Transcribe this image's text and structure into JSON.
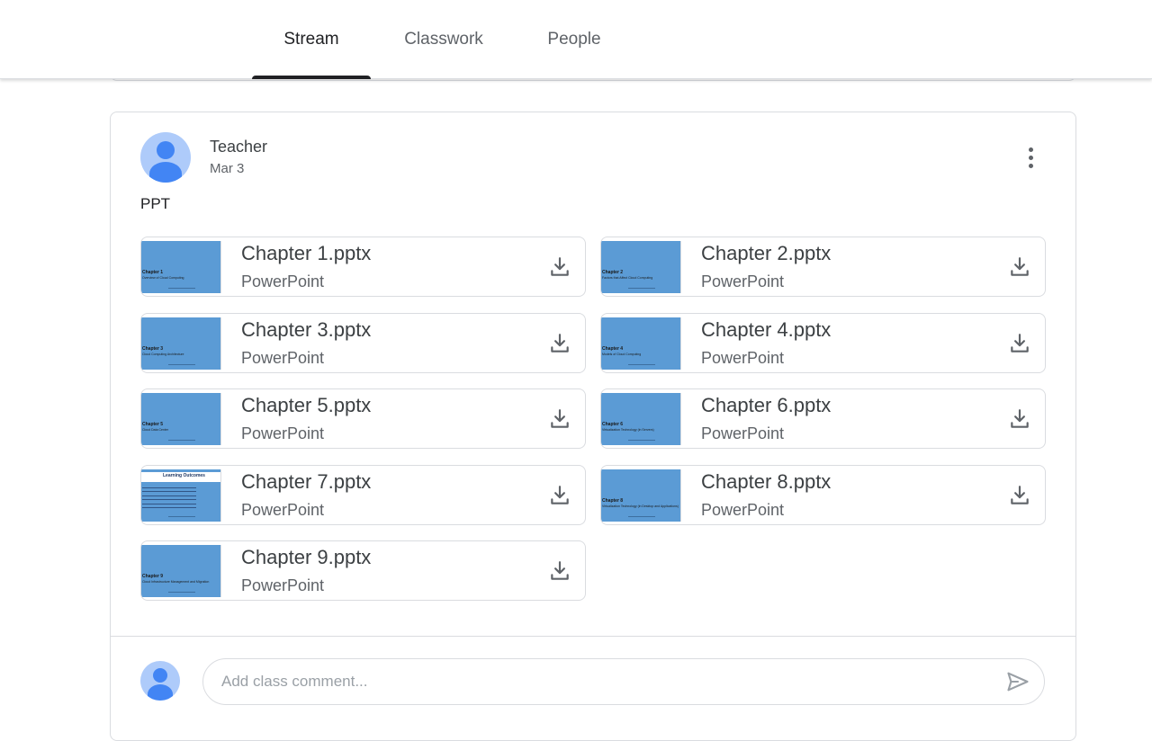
{
  "tabs": [
    {
      "label": "Stream",
      "active": true
    },
    {
      "label": "Classwork",
      "active": false
    },
    {
      "label": "People",
      "active": false
    }
  ],
  "post": {
    "author": "Teacher",
    "date": "Mar 3",
    "text": "PPT",
    "attachments": [
      {
        "name": "Chapter 1.pptx",
        "type": "PowerPoint",
        "thumb_title": "Chapter 1",
        "thumb_subtitle": "Overview of Cloud Computing"
      },
      {
        "name": "Chapter 2.pptx",
        "type": "PowerPoint",
        "thumb_title": "Chapter 2",
        "thumb_subtitle": "Factors that Affect Cloud Computing"
      },
      {
        "name": "Chapter 3.pptx",
        "type": "PowerPoint",
        "thumb_title": "Chapter 3",
        "thumb_subtitle": "Cloud Computing Architecture"
      },
      {
        "name": "Chapter 4.pptx",
        "type": "PowerPoint",
        "thumb_title": "Chapter 4",
        "thumb_subtitle": "Models of Cloud Computing"
      },
      {
        "name": "Chapter 5.pptx",
        "type": "PowerPoint",
        "thumb_title": "Chapter 5",
        "thumb_subtitle": "Cloud Data Center"
      },
      {
        "name": "Chapter 6.pptx",
        "type": "PowerPoint",
        "thumb_title": "Chapter 6",
        "thumb_subtitle": "Virtualization Technology (in Servers)"
      },
      {
        "name": "Chapter 7.pptx",
        "type": "PowerPoint",
        "thumb_title": "Learning Outcomes",
        "thumb_subtitle": ""
      },
      {
        "name": "Chapter 8.pptx",
        "type": "PowerPoint",
        "thumb_title": "Chapter 8",
        "thumb_subtitle": "Virtualization Technology (in Desktop and Applications)"
      },
      {
        "name": "Chapter 9.pptx",
        "type": "PowerPoint",
        "thumb_title": "Chapter 9",
        "thumb_subtitle": "Cloud Infrastructure Management and Migration"
      }
    ]
  },
  "comment": {
    "placeholder": "Add class comment..."
  },
  "icons": {
    "more": "more-vert-icon",
    "download": "download-icon",
    "send": "send-icon"
  },
  "colors": {
    "thumb_bg": "#5b9bd5",
    "avatar_bg": "#aecbfa",
    "avatar_fg": "#4285f4"
  }
}
